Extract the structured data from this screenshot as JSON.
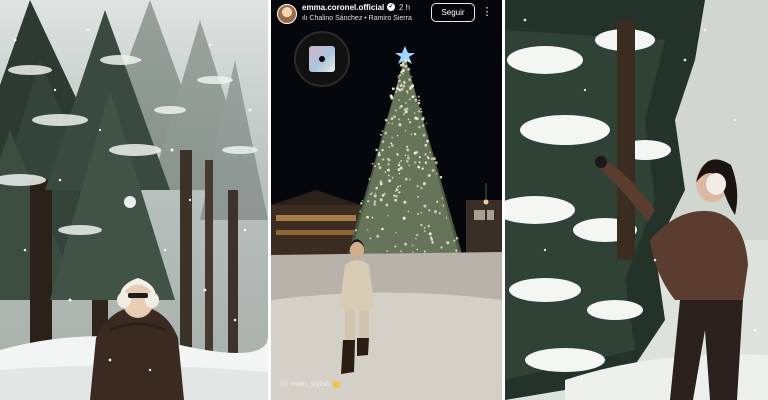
{
  "story": {
    "username": "emma.coronel.official",
    "time_ago": "2 h",
    "music_icon": "music-bars-icon",
    "music_text": "Chalino Sánchez • Ramiro Sierra",
    "follow_label": "Seguir",
    "more_label": "⋮",
    "tag_text": "mom_stylish"
  },
  "icons": {
    "verified": "verified-badge-icon",
    "more": "three-dots-icon"
  },
  "colors": {
    "story_background": "#07070b",
    "tree_lights": "#f4eed0",
    "star": "#9fd6ff",
    "snow": "#ffffff"
  }
}
